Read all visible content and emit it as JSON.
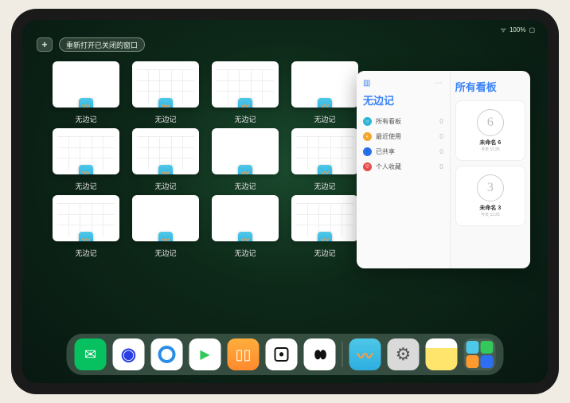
{
  "status": {
    "battery_text": "100%"
  },
  "controls": {
    "plus_symbol": "+",
    "reopen_label": "重新打开已关闭的窗口"
  },
  "app_name": "无边记",
  "windows": [
    {
      "label": "无边记",
      "variant": "blank"
    },
    {
      "label": "无边记",
      "variant": "calendar"
    },
    {
      "label": "无边记",
      "variant": "calendar"
    },
    {
      "label": "无边记",
      "variant": "blank"
    },
    {
      "label": "无边记",
      "variant": "calendar"
    },
    {
      "label": "无边记",
      "variant": "calendar"
    },
    {
      "label": "无边记",
      "variant": "blank"
    },
    {
      "label": "无边记",
      "variant": "calendar"
    },
    {
      "label": "无边记",
      "variant": "calendar"
    },
    {
      "label": "无边记",
      "variant": "blank"
    },
    {
      "label": "无边记",
      "variant": "blank"
    },
    {
      "label": "无边记",
      "variant": "calendar"
    }
  ],
  "detail": {
    "sidebar_title": "无边记",
    "items": [
      {
        "icon": "○",
        "label": "所有看板",
        "count": "0",
        "color": "#2fb6d6"
      },
      {
        "icon": "◐",
        "label": "最近使用",
        "count": "0",
        "color": "#f3a62e"
      },
      {
        "icon": "👤",
        "label": "已共享",
        "count": "0",
        "color": "#2e6ef0"
      },
      {
        "icon": "♡",
        "label": "个人收藏",
        "count": "0",
        "color": "#e44d4a"
      }
    ],
    "main_title": "所有看板",
    "boards": [
      {
        "sketch": "6",
        "name": "未命名 6",
        "sub": "今天 11:25"
      },
      {
        "sketch": "3",
        "name": "未命名 3",
        "sub": "今天 11:25"
      }
    ]
  },
  "dock": {
    "apps": [
      {
        "name": "wechat",
        "bg": "#07c160",
        "glyph": "💬"
      },
      {
        "name": "quark-hd",
        "bg": "#ffffff",
        "glyph": "◉"
      },
      {
        "name": "quark",
        "bg": "#ffffff",
        "glyph": "◯"
      },
      {
        "name": "play",
        "bg": "#ffffff",
        "glyph": "▶"
      },
      {
        "name": "books",
        "bg": "#ff9a2e",
        "glyph": "📖"
      },
      {
        "name": "dice",
        "bg": "#ffffff",
        "glyph": "⊡"
      },
      {
        "name": "dots",
        "bg": "#ffffff",
        "glyph": "⋮⋮"
      }
    ],
    "recent": [
      {
        "name": "freeform",
        "bg": "linear-gradient(180deg,#4ec8e8,#2daee0)",
        "glyph": "〰"
      },
      {
        "name": "settings",
        "bg": "#d9d9d9",
        "glyph": "⚙"
      },
      {
        "name": "notes",
        "bg": "#fff26b",
        "glyph": ""
      }
    ]
  }
}
